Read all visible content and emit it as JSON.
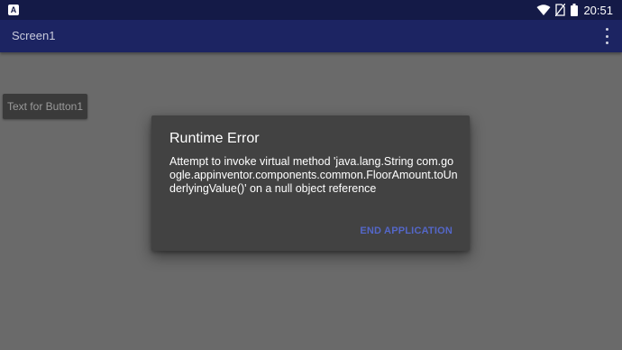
{
  "status_bar": {
    "app_icon_letter": "A",
    "time": "20:51",
    "icons": [
      "wifi-icon",
      "no-sim-icon",
      "battery-icon"
    ]
  },
  "app_bar": {
    "title": "Screen1",
    "menu_icon": "overflow-menu-icon"
  },
  "content": {
    "button1_label": "Text for Button1"
  },
  "dialog": {
    "title": "Runtime Error",
    "message": "Attempt to invoke virtual method 'java.lang.String com.google.appinventor.components.common.FloorAmount.toUnderlyingValue()' on a null object reference",
    "action_label": "END APPLICATION"
  },
  "colors": {
    "status_bar": "#141a47",
    "app_bar": "#1c2462",
    "background": "#6a6a6a",
    "dialog": "#424242",
    "accent": "#5467c8"
  }
}
